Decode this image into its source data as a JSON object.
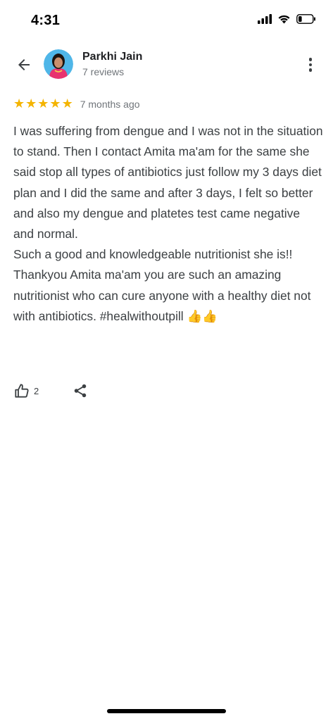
{
  "status_bar": {
    "time": "4:31",
    "icons": [
      "signal-icon",
      "wifi-icon",
      "battery-icon"
    ],
    "battery_level": 0.2
  },
  "header": {
    "reviewer_name": "Parkhi Jain",
    "reviewer_reviews": "7 reviews"
  },
  "rating": {
    "stars": 5,
    "max_stars": 5,
    "time_ago": "7 months ago",
    "star_color": "#f4b400"
  },
  "review": {
    "paragraph_1": "I was suffering from dengue and I was not in the situation to stand. Then I contact Amita ma'am for the same she said stop all types of antibiotics just follow my 3 days diet plan and I did the same and after 3 days, I felt so better and also my dengue and platetes test came negative and normal.",
    "paragraph_2": "Such a good and knowledgeable nutritionist she is!!",
    "paragraph_3": "Thankyou Amita ma'am you are such an amazing nutritionist who can cure anyone with a healthy diet not with antibiotics. #healwithoutpill",
    "emoji": "👍👍"
  },
  "actions": {
    "like_count": "2"
  }
}
